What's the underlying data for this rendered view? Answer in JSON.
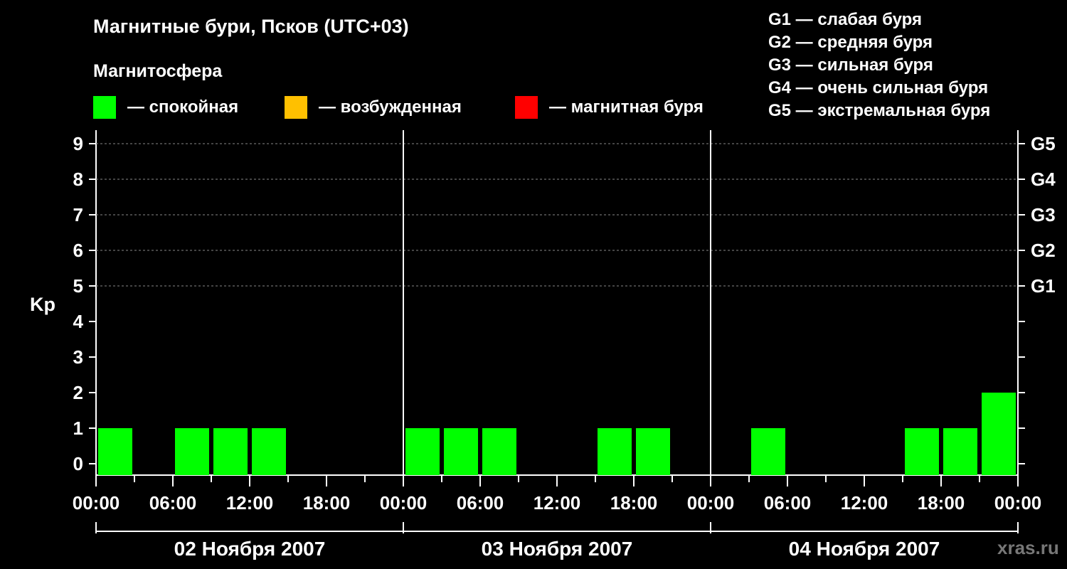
{
  "header": {
    "title": "Магнитные бури, Псков (UTC+03)",
    "legend_heading": "Магнитосфера"
  },
  "legend": [
    {
      "label": "— спокойная",
      "color": "#00ff00"
    },
    {
      "label": "— возбужденная",
      "color": "#ffc000"
    },
    {
      "label": "— магнитная буря",
      "color": "#ff0000"
    }
  ],
  "storm_scale": [
    "G1 — слабая буря",
    "G2 — средняя буря",
    "G3 — сильная буря",
    "G4 — очень сильная буря",
    "G5 — экстремальная буря"
  ],
  "watermark": "xras.ru",
  "chart_data": {
    "type": "bar",
    "ylabel": "Kp",
    "ylim": [
      0,
      9
    ],
    "yticks": [
      0,
      1,
      2,
      3,
      4,
      5,
      6,
      7,
      8,
      9
    ],
    "right_axis_labels": [
      {
        "kp": 5,
        "label": "G1"
      },
      {
        "kp": 6,
        "label": "G2"
      },
      {
        "kp": 7,
        "label": "G3"
      },
      {
        "kp": 8,
        "label": "G4"
      },
      {
        "kp": 9,
        "label": "G5"
      }
    ],
    "xtick_labels": [
      "00:00",
      "06:00",
      "12:00",
      "18:00",
      "00:00",
      "06:00",
      "12:00",
      "18:00",
      "00:00",
      "06:00",
      "12:00",
      "18:00",
      "00:00"
    ],
    "days": [
      "02 Ноября 2007",
      "03 Ноября 2007",
      "04 Ноября 2007"
    ],
    "interval_hours": 3,
    "grid": "dashed horizontal lines at Kp 5–9",
    "series": [
      {
        "values": [
          1,
          0,
          1,
          1,
          1,
          0,
          0,
          0,
          1,
          1,
          1,
          0,
          0,
          1,
          1,
          0,
          0,
          1,
          0,
          0,
          0,
          1,
          1,
          2
        ],
        "colors": [
          "#00ff00",
          "#00ff00",
          "#00ff00",
          "#00ff00",
          "#00ff00",
          "#00ff00",
          "#00ff00",
          "#00ff00",
          "#00ff00",
          "#00ff00",
          "#00ff00",
          "#00ff00",
          "#00ff00",
          "#00ff00",
          "#00ff00",
          "#00ff00",
          "#00ff00",
          "#00ff00",
          "#00ff00",
          "#00ff00",
          "#00ff00",
          "#00ff00",
          "#00ff00",
          "#00ff00"
        ]
      }
    ]
  }
}
